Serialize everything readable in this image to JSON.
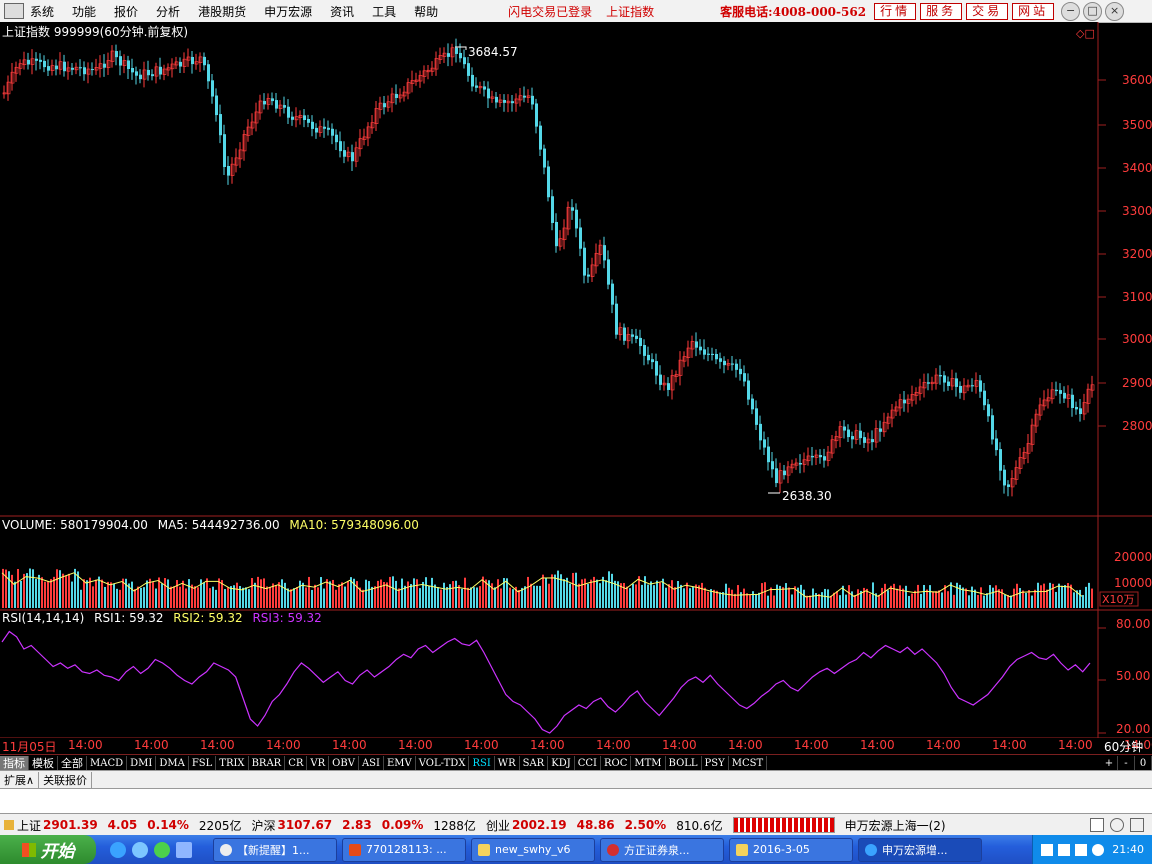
{
  "menu": [
    "系统",
    "功能",
    "报价",
    "分析",
    "港股期货",
    "申万宏源",
    "资讯",
    "工具",
    "帮助"
  ],
  "notice": [
    "闪电交易已登录",
    "上证指数"
  ],
  "hotline": "客服电话:4008-000-562",
  "top_buttons": [
    "行情",
    "服务",
    "交易",
    "网站"
  ],
  "window_buttons": [
    "−",
    "□",
    "×"
  ],
  "chart_header": "上证指数 999999(60分钟.前复权)",
  "price_axis": [
    "3600",
    "3500",
    "3400",
    "3300",
    "3200",
    "3100",
    "3000",
    "2900",
    "2800"
  ],
  "high_label": "3684.57",
  "low_label": "2638.30",
  "volume_header": {
    "vol": "VOLUME: 580179904.00",
    "ma5": "MA5: 544492736.00",
    "ma10": "MA10: 579348096.00"
  },
  "volume_axis": [
    "20000",
    "10000"
  ],
  "volume_unit": "X10万",
  "rsi_header": {
    "name": "RSI(14,14,14)",
    "rsi1": "RSI1: 59.32",
    "rsi2": "RSI2: 59.32",
    "rsi3": "RSI3: 59.32"
  },
  "rsi_axis": [
    "80.00",
    "50.00",
    "20.00"
  ],
  "time_axis": [
    "11月05日",
    "14:00",
    "14:00",
    "14:00",
    "14:00",
    "14:00",
    "14:00",
    "14:00",
    "14:00",
    "14:00",
    "14:00",
    "14:00",
    "14:00",
    "14:00",
    "14:00",
    "14:00",
    "14:00",
    "14:00"
  ],
  "period": "60分钟",
  "indicator_tabs": [
    "指标",
    "模板",
    "全部",
    "MACD",
    "DMI",
    "DMA",
    "FSL",
    "TRIX",
    "BRAR",
    "CR",
    "VR",
    "OBV",
    "ASI",
    "EMV",
    "VOL-TDX",
    "RSI",
    "WR",
    "SAR",
    "KDJ",
    "CCI",
    "ROC",
    "MTM",
    "BOLL",
    "PSY",
    "MCST"
  ],
  "active_tab": "RSI",
  "tab_controls": [
    "+",
    "-",
    "0"
  ],
  "ext_tabs": [
    "扩展∧",
    "关联报价"
  ],
  "status": {
    "sh_label": "上证",
    "sh_val": "2901.39",
    "sh_chg": "4.05",
    "sh_pct": "0.14%",
    "sh_amt": "2205亿",
    "hs_label": "沪深",
    "hs_val": "3107.67",
    "hs_chg": "2.83",
    "hs_pct": "0.09%",
    "hs_amt": "1288亿",
    "cy_label": "创业",
    "cy_val": "2002.19",
    "cy_chg": "48.86",
    "cy_pct": "2.50%",
    "cy_amt": "810.6亿",
    "server": "申万宏源上海一(2)"
  },
  "taskbar": {
    "start": "开始",
    "items": [
      "【新提醒】1...",
      "770128113: ...",
      "new_swhy_v6",
      "方正证券泉...",
      "2016-3-05",
      "申万宏源增..."
    ],
    "clock": "21:40"
  },
  "colors": {
    "up": "#ff3c3c",
    "down": "#54d8e8",
    "rsi": "#cc33ff",
    "ma10": "#ffff66",
    "grid": "#7a1f1f"
  }
}
